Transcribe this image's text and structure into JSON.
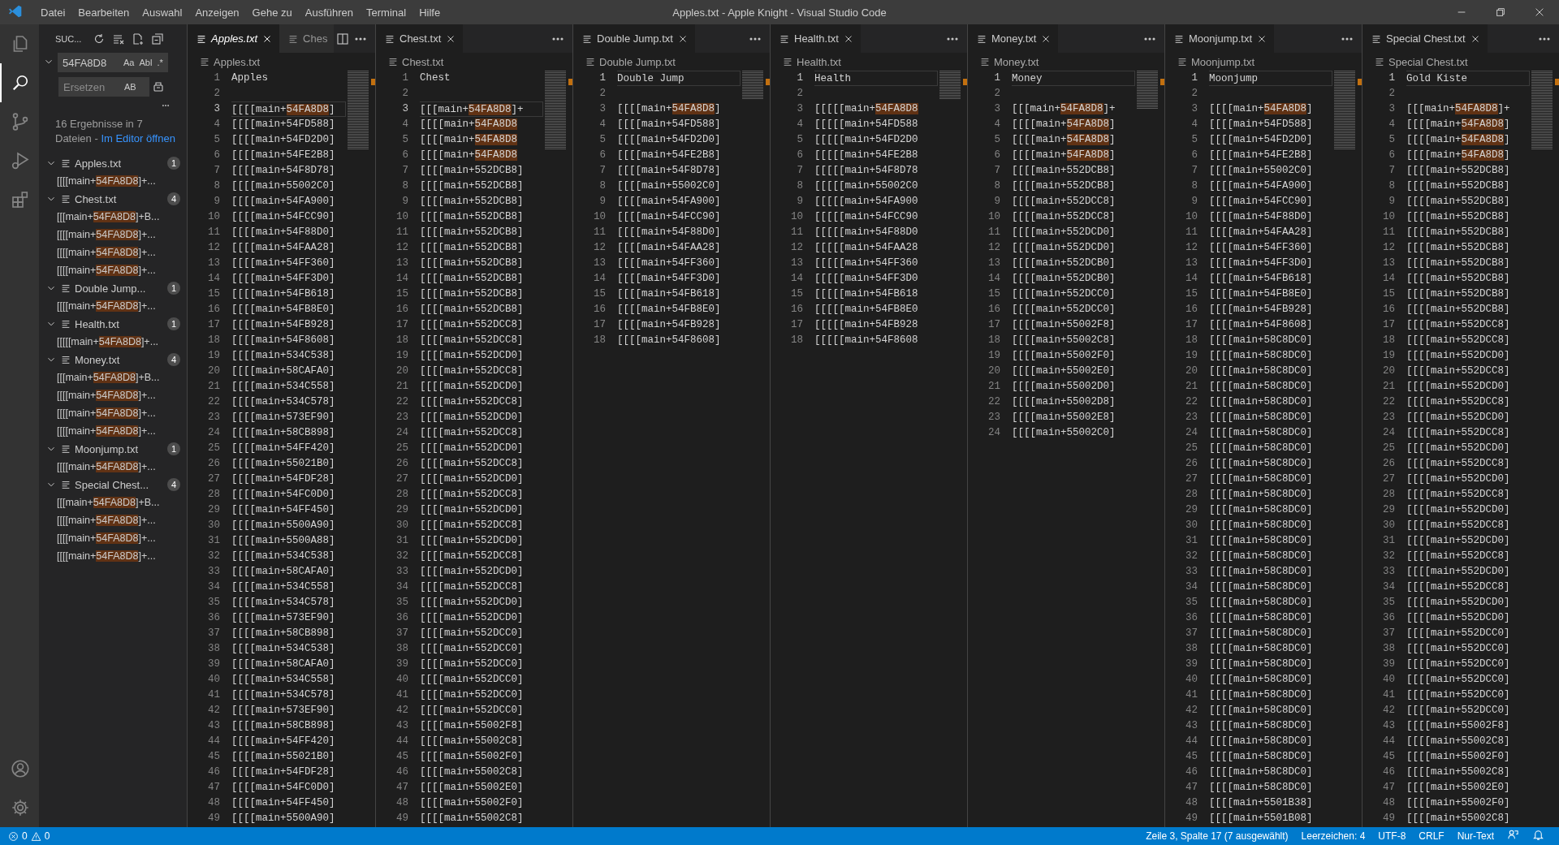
{
  "title_bar": {
    "menus": [
      "Datei",
      "Bearbeiten",
      "Auswahl",
      "Anzeigen",
      "Gehe zu",
      "Ausführen",
      "Terminal",
      "Hilfe"
    ],
    "title": "Apples.txt - Apple Knight - Visual Studio Code"
  },
  "activity_bar": {
    "items": [
      {
        "kind": "files",
        "selected": false
      },
      {
        "kind": "search",
        "selected": true
      },
      {
        "kind": "source-control",
        "selected": false
      },
      {
        "kind": "run",
        "selected": false
      },
      {
        "kind": "extensions",
        "selected": false
      }
    ],
    "bottom": [
      {
        "kind": "account"
      },
      {
        "kind": "settings"
      }
    ]
  },
  "search": {
    "header": "SUC...",
    "query": "54FA8D8",
    "query_options": [
      {
        "label": "Aa",
        "on": false
      },
      {
        "label": "Abl",
        "on": false
      },
      {
        "label": ".*",
        "on": false
      }
    ],
    "replace_placeholder": "Ersetzen",
    "replace_option": "AB",
    "replace_expanded": true,
    "summary": "16 Ergebnisse in 7 Dateien - ",
    "open_link": "Im Editor öffnen",
    "results": [
      {
        "name": "Apples.txt",
        "count": "1",
        "expanded": true,
        "matches": [
          {
            "before": "[[[[main+",
            "match": "54FA8D8",
            "after": "]+..."
          }
        ]
      },
      {
        "name": "Chest.txt",
        "count": "4",
        "expanded": true,
        "matches": [
          {
            "before": "[[[main+",
            "match": "54FA8D8",
            "after": "]+B..."
          },
          {
            "before": "[[[[main+",
            "match": "54FA8D8",
            "after": "]+..."
          },
          {
            "before": "[[[[main+",
            "match": "54FA8D8",
            "after": "]+..."
          },
          {
            "before": "[[[[main+",
            "match": "54FA8D8",
            "after": "]+..."
          }
        ]
      },
      {
        "name": "Double Jump...",
        "count": "1",
        "expanded": true,
        "matches": [
          {
            "before": "[[[[main+",
            "match": "54FA8D8",
            "after": "]+..."
          }
        ]
      },
      {
        "name": "Health.txt",
        "count": "1",
        "expanded": true,
        "matches": [
          {
            "before": "[[[[[main+",
            "match": "54FA8D8",
            "after": "]+..."
          }
        ]
      },
      {
        "name": "Money.txt",
        "count": "4",
        "expanded": true,
        "matches": [
          {
            "before": "[[[main+",
            "match": "54FA8D8",
            "after": "]+B..."
          },
          {
            "before": "[[[[main+",
            "match": "54FA8D8",
            "after": "]+..."
          },
          {
            "before": "[[[[main+",
            "match": "54FA8D8",
            "after": "]+..."
          },
          {
            "before": "[[[[main+",
            "match": "54FA8D8",
            "after": "]+..."
          }
        ]
      },
      {
        "name": "Moonjump.txt",
        "count": "1",
        "expanded": true,
        "matches": [
          {
            "before": "[[[[main+",
            "match": "54FA8D8",
            "after": "]+..."
          }
        ]
      },
      {
        "name": "Special Chest...",
        "count": "4",
        "expanded": true,
        "matches": [
          {
            "before": "[[[main+",
            "match": "54FA8D8",
            "after": "]+B..."
          },
          {
            "before": "[[[[main+",
            "match": "54FA8D8",
            "after": "]+..."
          },
          {
            "before": "[[[[main+",
            "match": "54FA8D8",
            "after": "]+..."
          },
          {
            "before": "[[[[main+",
            "match": "54FA8D8",
            "after": "]+..."
          }
        ]
      }
    ]
  },
  "editor_groups": [
    {
      "focused": true,
      "tabs": [
        {
          "label": "Apples.txt",
          "selected": true,
          "preview": true
        },
        {
          "label": "Ches",
          "selected": false,
          "preview": false
        }
      ],
      "actions": [
        {
          "kind": "split"
        },
        {
          "kind": "more"
        }
      ],
      "breadcrumb": "Apples.txt",
      "lines": [
        {
          "n": "1",
          "text": "Apples",
          "current": false
        },
        {
          "n": "2",
          "current": false
        },
        {
          "n": "3",
          "text": "[[[[main+",
          "match": "54FA8D8",
          "rest": "]",
          "current": true
        },
        {
          "n": "4",
          "text": "[[[[main+54FD588]",
          "current": false
        },
        {
          "n": "5",
          "text": "[[[[main+54FD2D0]",
          "current": false
        },
        {
          "n": "6",
          "text": "[[[[main+54FE2B8]",
          "current": false
        },
        {
          "n": "7",
          "text": "[[[[main+54F8D78]",
          "current": false
        },
        {
          "n": "8",
          "text": "[[[[main+55002C0]",
          "current": false
        },
        {
          "n": "9",
          "text": "[[[[main+54FA900]",
          "current": false
        },
        {
          "n": "10",
          "text": "[[[[main+54FCC90]",
          "current": false
        },
        {
          "n": "11",
          "text": "[[[[main+54F88D0]",
          "current": false
        },
        {
          "n": "12",
          "text": "[[[[main+54FAA28]",
          "current": false
        },
        {
          "n": "13",
          "text": "[[[[main+54FF360]",
          "current": false
        },
        {
          "n": "14",
          "text": "[[[[main+54FF3D0]",
          "current": false
        },
        {
          "n": "15",
          "text": "[[[[main+54FB618]",
          "current": false
        },
        {
          "n": "16",
          "text": "[[[[main+54FB8E0]",
          "current": false
        },
        {
          "n": "17",
          "text": "[[[[main+54FB928]",
          "current": false
        },
        {
          "n": "18",
          "text": "[[[[main+54F8608]",
          "current": false
        },
        {
          "n": "19",
          "text": "[[[[main+534C538]",
          "current": false
        },
        {
          "n": "20",
          "text": "[[[[main+58CAFA0]",
          "current": false
        },
        {
          "n": "21",
          "text": "[[[[main+534C558]",
          "current": false
        },
        {
          "n": "22",
          "text": "[[[[main+534C578]",
          "current": false
        },
        {
          "n": "23",
          "text": "[[[[main+573EF90]",
          "current": false
        },
        {
          "n": "24",
          "text": "[[[[main+58CB898]",
          "current": false
        },
        {
          "n": "25",
          "text": "[[[[main+54FF420]",
          "current": false
        },
        {
          "n": "26",
          "text": "[[[[main+55021B0]",
          "current": false
        },
        {
          "n": "27",
          "text": "[[[[main+54FDF28]",
          "current": false
        },
        {
          "n": "28",
          "text": "[[[[main+54FC0D0]",
          "current": false
        },
        {
          "n": "29",
          "text": "[[[[main+54FF450]",
          "current": false
        },
        {
          "n": "30",
          "text": "[[[[main+5500A90]",
          "current": false
        },
        {
          "n": "31",
          "text": "[[[[main+5500A88]",
          "current": false
        },
        {
          "n": "32",
          "text": "[[[[main+534C538]",
          "current": false
        },
        {
          "n": "33",
          "text": "[[[[main+58CAFA0]",
          "current": false
        },
        {
          "n": "34",
          "text": "[[[[main+534C558]",
          "current": false
        },
        {
          "n": "35",
          "text": "[[[[main+534C578]",
          "current": false
        },
        {
          "n": "36",
          "text": "[[[[main+573EF90]",
          "current": false
        },
        {
          "n": "37",
          "text": "[[[[main+58CB898]",
          "current": false
        },
        {
          "n": "38",
          "text": "[[[[main+534C538]",
          "current": false
        },
        {
          "n": "39",
          "text": "[[[[main+58CAFA0]",
          "current": false
        },
        {
          "n": "40",
          "text": "[[[[main+534C558]",
          "current": false
        },
        {
          "n": "41",
          "text": "[[[[main+534C578]",
          "current": false
        },
        {
          "n": "42",
          "text": "[[[[main+573EF90]",
          "current": false
        },
        {
          "n": "43",
          "text": "[[[[main+58CB898]",
          "current": false
        },
        {
          "n": "44",
          "text": "[[[[main+54FF420]",
          "current": false
        },
        {
          "n": "45",
          "text": "[[[[main+55021B0]",
          "current": false
        },
        {
          "n": "46",
          "text": "[[[[main+54FDF28]",
          "current": false
        },
        {
          "n": "47",
          "text": "[[[[main+54FC0D0]",
          "current": false
        },
        {
          "n": "48",
          "text": "[[[[main+54FF450]",
          "current": false
        },
        {
          "n": "49",
          "text": "[[[[main+5500A90]",
          "current": false
        }
      ]
    },
    {
      "focused": false,
      "tabs": [
        {
          "label": "Chest.txt",
          "selected": true,
          "preview": false
        }
      ],
      "actions": [
        {
          "kind": "more"
        }
      ],
      "breadcrumb": "Chest.txt",
      "lines": [
        {
          "n": "1",
          "text": "Chest",
          "current": false
        },
        {
          "n": "2",
          "current": false
        },
        {
          "n": "3",
          "text": "[[[main+",
          "match": "54FA8D8",
          "rest": "]+",
          "current": true
        },
        {
          "n": "4",
          "text": "[[[[main+",
          "match": "54FA8D8",
          "current": false
        },
        {
          "n": "5",
          "text": "[[[[main+",
          "match": "54FA8D8",
          "current": false
        },
        {
          "n": "6",
          "text": "[[[[main+",
          "match": "54FA8D8",
          "current": false
        },
        {
          "n": "7",
          "text": "[[[[main+552DCB8]",
          "current": false
        },
        {
          "n": "8",
          "text": "[[[[main+552DCB8]",
          "current": false
        },
        {
          "n": "9",
          "text": "[[[[main+552DCB8]",
          "current": false
        },
        {
          "n": "10",
          "text": "[[[[main+552DCB8]",
          "current": false
        },
        {
          "n": "11",
          "text": "[[[[main+552DCB8]",
          "current": false
        },
        {
          "n": "12",
          "text": "[[[[main+552DCB8]",
          "current": false
        },
        {
          "n": "13",
          "text": "[[[[main+552DCB8]",
          "current": false
        },
        {
          "n": "14",
          "text": "[[[[main+552DCB8]",
          "current": false
        },
        {
          "n": "15",
          "text": "[[[[main+552DCB8]",
          "current": false
        },
        {
          "n": "16",
          "text": "[[[[main+552DCB8]",
          "current": false
        },
        {
          "n": "17",
          "text": "[[[[main+552DCC8]",
          "current": false
        },
        {
          "n": "18",
          "text": "[[[[main+552DCC8]",
          "current": false
        },
        {
          "n": "19",
          "text": "[[[[main+552DCD0]",
          "current": false
        },
        {
          "n": "20",
          "text": "[[[[main+552DCC8]",
          "current": false
        },
        {
          "n": "21",
          "text": "[[[[main+552DCD0]",
          "current": false
        },
        {
          "n": "22",
          "text": "[[[[main+552DCC8]",
          "current": false
        },
        {
          "n": "23",
          "text": "[[[[main+552DCD0]",
          "current": false
        },
        {
          "n": "24",
          "text": "[[[[main+552DCC8]",
          "current": false
        },
        {
          "n": "25",
          "text": "[[[[main+552DCD0]",
          "current": false
        },
        {
          "n": "26",
          "text": "[[[[main+552DCC8]",
          "current": false
        },
        {
          "n": "27",
          "text": "[[[[main+552DCD0]",
          "current": false
        },
        {
          "n": "28",
          "text": "[[[[main+552DCC8]",
          "current": false
        },
        {
          "n": "29",
          "text": "[[[[main+552DCD0]",
          "current": false
        },
        {
          "n": "30",
          "text": "[[[[main+552DCC8]",
          "current": false
        },
        {
          "n": "31",
          "text": "[[[[main+552DCD0]",
          "current": false
        },
        {
          "n": "32",
          "text": "[[[[main+552DCC8]",
          "current": false
        },
        {
          "n": "33",
          "text": "[[[[main+552DCD0]",
          "current": false
        },
        {
          "n": "34",
          "text": "[[[[main+552DCC8]",
          "current": false
        },
        {
          "n": "35",
          "text": "[[[[main+552DCD0]",
          "current": false
        },
        {
          "n": "36",
          "text": "[[[[main+552DCD0]",
          "current": false
        },
        {
          "n": "37",
          "text": "[[[[main+552DCC0]",
          "current": false
        },
        {
          "n": "38",
          "text": "[[[[main+552DCC0]",
          "current": false
        },
        {
          "n": "39",
          "text": "[[[[main+552DCC0]",
          "current": false
        },
        {
          "n": "40",
          "text": "[[[[main+552DCC0]",
          "current": false
        },
        {
          "n": "41",
          "text": "[[[[main+552DCC0]",
          "current": false
        },
        {
          "n": "42",
          "text": "[[[[main+552DCC0]",
          "current": false
        },
        {
          "n": "43",
          "text": "[[[[main+55002F8]",
          "current": false
        },
        {
          "n": "44",
          "text": "[[[[main+55002C8]",
          "current": false
        },
        {
          "n": "45",
          "text": "[[[[main+55002F0]",
          "current": false
        },
        {
          "n": "46",
          "text": "[[[[main+55002C8]",
          "current": false
        },
        {
          "n": "47",
          "text": "[[[[main+55002E0]",
          "current": false
        },
        {
          "n": "48",
          "text": "[[[[main+55002F0]",
          "current": false
        },
        {
          "n": "49",
          "text": "[[[[main+55002C8]",
          "current": false
        }
      ]
    },
    {
      "focused": false,
      "tabs": [
        {
          "label": "Double Jump.txt",
          "selected": true,
          "preview": false
        }
      ],
      "actions": [
        {
          "kind": "more"
        }
      ],
      "breadcrumb": "Double Jump.txt",
      "lines": [
        {
          "n": "1",
          "text": "Double Jump",
          "current": true
        },
        {
          "n": "2",
          "current": false
        },
        {
          "n": "3",
          "text": "[[[[main+",
          "match": "54FA8D8",
          "rest": "]",
          "current": false
        },
        {
          "n": "4",
          "text": "[[[[main+54FD588]",
          "current": false
        },
        {
          "n": "5",
          "text": "[[[[main+54FD2D0]",
          "current": false
        },
        {
          "n": "6",
          "text": "[[[[main+54FE2B8]",
          "current": false
        },
        {
          "n": "7",
          "text": "[[[[main+54F8D78]",
          "current": false
        },
        {
          "n": "8",
          "text": "[[[[main+55002C0]",
          "current": false
        },
        {
          "n": "9",
          "text": "[[[[main+54FA900]",
          "current": false
        },
        {
          "n": "10",
          "text": "[[[[main+54FCC90]",
          "current": false
        },
        {
          "n": "11",
          "text": "[[[[main+54F88D0]",
          "current": false
        },
        {
          "n": "12",
          "text": "[[[[main+54FAA28]",
          "current": false
        },
        {
          "n": "13",
          "text": "[[[[main+54FF360]",
          "current": false
        },
        {
          "n": "14",
          "text": "[[[[main+54FF3D0]",
          "current": false
        },
        {
          "n": "15",
          "text": "[[[[main+54FB618]",
          "current": false
        },
        {
          "n": "16",
          "text": "[[[[main+54FB8E0]",
          "current": false
        },
        {
          "n": "17",
          "text": "[[[[main+54FB928]",
          "current": false
        },
        {
          "n": "18",
          "text": "[[[[main+54F8608]",
          "current": false
        }
      ]
    },
    {
      "focused": false,
      "tabs": [
        {
          "label": "Health.txt",
          "selected": true,
          "preview": false
        }
      ],
      "actions": [
        {
          "kind": "more"
        }
      ],
      "breadcrumb": "Health.txt",
      "lines": [
        {
          "n": "1",
          "text": "Health",
          "current": true
        },
        {
          "n": "2",
          "current": false
        },
        {
          "n": "3",
          "text": "[[[[[main+",
          "match": "54FA8D8",
          "current": false
        },
        {
          "n": "4",
          "text": "[[[[[main+54FD588",
          "current": false
        },
        {
          "n": "5",
          "text": "[[[[[main+54FD2D0",
          "current": false
        },
        {
          "n": "6",
          "text": "[[[[[main+54FE2B8",
          "current": false
        },
        {
          "n": "7",
          "text": "[[[[[main+54F8D78",
          "current": false
        },
        {
          "n": "8",
          "text": "[[[[[main+55002C0",
          "current": false
        },
        {
          "n": "9",
          "text": "[[[[[main+54FA900",
          "current": false
        },
        {
          "n": "10",
          "text": "[[[[[main+54FCC90",
          "current": false
        },
        {
          "n": "11",
          "text": "[[[[[main+54F88D0",
          "current": false
        },
        {
          "n": "12",
          "text": "[[[[[main+54FAA28",
          "current": false
        },
        {
          "n": "13",
          "text": "[[[[[main+54FF360",
          "current": false
        },
        {
          "n": "14",
          "text": "[[[[[main+54FF3D0",
          "current": false
        },
        {
          "n": "15",
          "text": "[[[[[main+54FB618",
          "current": false
        },
        {
          "n": "16",
          "text": "[[[[[main+54FB8E0",
          "current": false
        },
        {
          "n": "17",
          "text": "[[[[[main+54FB928",
          "current": false
        },
        {
          "n": "18",
          "text": "[[[[[main+54F8608",
          "current": false
        }
      ]
    },
    {
      "focused": false,
      "tabs": [
        {
          "label": "Money.txt",
          "selected": true,
          "preview": false
        }
      ],
      "actions": [
        {
          "kind": "more"
        }
      ],
      "breadcrumb": "Money.txt",
      "lines": [
        {
          "n": "1",
          "text": "Money",
          "current": true
        },
        {
          "n": "2",
          "current": false
        },
        {
          "n": "3",
          "text": "[[[main+",
          "match": "54FA8D8",
          "rest": "]+",
          "current": false
        },
        {
          "n": "4",
          "text": "[[[[main+",
          "match": "54FA8D8",
          "rest": "]",
          "current": false
        },
        {
          "n": "5",
          "text": "[[[[main+",
          "match": "54FA8D8",
          "rest": "]",
          "current": false
        },
        {
          "n": "6",
          "text": "[[[[main+",
          "match": "54FA8D8",
          "rest": "]",
          "current": false
        },
        {
          "n": "7",
          "text": "[[[[main+552DCB8]",
          "current": false
        },
        {
          "n": "8",
          "text": "[[[[main+552DCB8]",
          "current": false
        },
        {
          "n": "9",
          "text": "[[[[main+552DCC8]",
          "current": false
        },
        {
          "n": "10",
          "text": "[[[[main+552DCC8]",
          "current": false
        },
        {
          "n": "11",
          "text": "[[[[main+552DCD0]",
          "current": false
        },
        {
          "n": "12",
          "text": "[[[[main+552DCD0]",
          "current": false
        },
        {
          "n": "13",
          "text": "[[[[main+552DCB0]",
          "current": false
        },
        {
          "n": "14",
          "text": "[[[[main+552DCB0]",
          "current": false
        },
        {
          "n": "15",
          "text": "[[[[main+552DCC0]",
          "current": false
        },
        {
          "n": "16",
          "text": "[[[[main+552DCC0]",
          "current": false
        },
        {
          "n": "17",
          "text": "[[[[main+55002F8]",
          "current": false
        },
        {
          "n": "18",
          "text": "[[[[main+55002C8]",
          "current": false
        },
        {
          "n": "19",
          "text": "[[[[main+55002F0]",
          "current": false
        },
        {
          "n": "20",
          "text": "[[[[main+55002E0]",
          "current": false
        },
        {
          "n": "21",
          "text": "[[[[main+55002D0]",
          "current": false
        },
        {
          "n": "22",
          "text": "[[[[main+55002D8]",
          "current": false
        },
        {
          "n": "23",
          "text": "[[[[main+55002E8]",
          "current": false
        },
        {
          "n": "24",
          "text": "[[[[main+55002C0]",
          "current": false
        }
      ]
    },
    {
      "focused": false,
      "tabs": [
        {
          "label": "Moonjump.txt",
          "selected": true,
          "preview": false
        }
      ],
      "actions": [
        {
          "kind": "more"
        }
      ],
      "breadcrumb": "Moonjump.txt",
      "lines": [
        {
          "n": "1",
          "text": "Moonjump",
          "current": true
        },
        {
          "n": "2",
          "current": false
        },
        {
          "n": "3",
          "text": "[[[[main+",
          "match": "54FA8D8",
          "rest": "]",
          "current": false
        },
        {
          "n": "4",
          "text": "[[[[main+54FD588]",
          "current": false
        },
        {
          "n": "5",
          "text": "[[[[main+54FD2D0]",
          "current": false
        },
        {
          "n": "6",
          "text": "[[[[main+54FE2B8]",
          "current": false
        },
        {
          "n": "7",
          "text": "[[[[main+55002C0]",
          "current": false
        },
        {
          "n": "8",
          "text": "[[[[main+54FA900]",
          "current": false
        },
        {
          "n": "9",
          "text": "[[[[main+54FCC90]",
          "current": false
        },
        {
          "n": "10",
          "text": "[[[[main+54F88D0]",
          "current": false
        },
        {
          "n": "11",
          "text": "[[[[main+54FAA28]",
          "current": false
        },
        {
          "n": "12",
          "text": "[[[[main+54FF360]",
          "current": false
        },
        {
          "n": "13",
          "text": "[[[[main+54FF3D0]",
          "current": false
        },
        {
          "n": "14",
          "text": "[[[[main+54FB618]",
          "current": false
        },
        {
          "n": "15",
          "text": "[[[[main+54FB8E0]",
          "current": false
        },
        {
          "n": "16",
          "text": "[[[[main+54FB928]",
          "current": false
        },
        {
          "n": "17",
          "text": "[[[[main+54F8608]",
          "current": false
        },
        {
          "n": "18",
          "text": "[[[[main+58C8DC0]",
          "current": false
        },
        {
          "n": "19",
          "text": "[[[[main+58C8DC0]",
          "current": false
        },
        {
          "n": "20",
          "text": "[[[[main+58C8DC0]",
          "current": false
        },
        {
          "n": "21",
          "text": "[[[[main+58C8DC0]",
          "current": false
        },
        {
          "n": "22",
          "text": "[[[[main+58C8DC0]",
          "current": false
        },
        {
          "n": "23",
          "text": "[[[[main+58C8DC0]",
          "current": false
        },
        {
          "n": "24",
          "text": "[[[[main+58C8DC0]",
          "current": false
        },
        {
          "n": "25",
          "text": "[[[[main+58C8DC0]",
          "current": false
        },
        {
          "n": "26",
          "text": "[[[[main+58C8DC0]",
          "current": false
        },
        {
          "n": "27",
          "text": "[[[[main+58C8DC0]",
          "current": false
        },
        {
          "n": "28",
          "text": "[[[[main+58C8DC0]",
          "current": false
        },
        {
          "n": "29",
          "text": "[[[[main+58C8DC0]",
          "current": false
        },
        {
          "n": "30",
          "text": "[[[[main+58C8DC0]",
          "current": false
        },
        {
          "n": "31",
          "text": "[[[[main+58C8DC0]",
          "current": false
        },
        {
          "n": "32",
          "text": "[[[[main+58C8DC0]",
          "current": false
        },
        {
          "n": "33",
          "text": "[[[[main+58C8DC0]",
          "current": false
        },
        {
          "n": "34",
          "text": "[[[[main+58C8DC0]",
          "current": false
        },
        {
          "n": "35",
          "text": "[[[[main+58C8DC0]",
          "current": false
        },
        {
          "n": "36",
          "text": "[[[[main+58C8DC0]",
          "current": false
        },
        {
          "n": "37",
          "text": "[[[[main+58C8DC0]",
          "current": false
        },
        {
          "n": "38",
          "text": "[[[[main+58C8DC0]",
          "current": false
        },
        {
          "n": "39",
          "text": "[[[[main+58C8DC0]",
          "current": false
        },
        {
          "n": "40",
          "text": "[[[[main+58C8DC0]",
          "current": false
        },
        {
          "n": "41",
          "text": "[[[[main+58C8DC0]",
          "current": false
        },
        {
          "n": "42",
          "text": "[[[[main+58C8DC0]",
          "current": false
        },
        {
          "n": "43",
          "text": "[[[[main+58C8DC0]",
          "current": false
        },
        {
          "n": "44",
          "text": "[[[[main+58C8DC0]",
          "current": false
        },
        {
          "n": "45",
          "text": "[[[[main+58C8DC0]",
          "current": false
        },
        {
          "n": "46",
          "text": "[[[[main+58C8DC0]",
          "current": false
        },
        {
          "n": "47",
          "text": "[[[[main+58C8DC0]",
          "current": false
        },
        {
          "n": "48",
          "text": "[[[[main+5501B38]",
          "current": false
        },
        {
          "n": "49",
          "text": "[[[[main+5501B08]",
          "current": false
        }
      ]
    },
    {
      "focused": false,
      "tabs": [
        {
          "label": "Special Chest.txt",
          "selected": true,
          "preview": false
        }
      ],
      "actions": [
        {
          "kind": "more"
        }
      ],
      "breadcrumb": "Special Chest.txt",
      "lines": [
        {
          "n": "1",
          "text": "Gold Kiste",
          "current": true
        },
        {
          "n": "2",
          "current": false
        },
        {
          "n": "3",
          "text": "[[[main+",
          "match": "54FA8D8",
          "rest": "]+",
          "current": false
        },
        {
          "n": "4",
          "text": "[[[[main+",
          "match": "54FA8D8",
          "rest": "]",
          "current": false
        },
        {
          "n": "5",
          "text": "[[[[main+",
          "match": "54FA8D8",
          "rest": "]",
          "current": false
        },
        {
          "n": "6",
          "text": "[[[[main+",
          "match": "54FA8D8",
          "rest": "]",
          "current": false
        },
        {
          "n": "7",
          "text": "[[[[main+552DCB8]",
          "current": false
        },
        {
          "n": "8",
          "text": "[[[[main+552DCB8]",
          "current": false
        },
        {
          "n": "9",
          "text": "[[[[main+552DCB8]",
          "current": false
        },
        {
          "n": "10",
          "text": "[[[[main+552DCB8]",
          "current": false
        },
        {
          "n": "11",
          "text": "[[[[main+552DCB8]",
          "current": false
        },
        {
          "n": "12",
          "text": "[[[[main+552DCB8]",
          "current": false
        },
        {
          "n": "13",
          "text": "[[[[main+552DCB8]",
          "current": false
        },
        {
          "n": "14",
          "text": "[[[[main+552DCB8]",
          "current": false
        },
        {
          "n": "15",
          "text": "[[[[main+552DCB8]",
          "current": false
        },
        {
          "n": "16",
          "text": "[[[[main+552DCB8]",
          "current": false
        },
        {
          "n": "17",
          "text": "[[[[main+552DCC8]",
          "current": false
        },
        {
          "n": "18",
          "text": "[[[[main+552DCC8]",
          "current": false
        },
        {
          "n": "19",
          "text": "[[[[main+552DCD0]",
          "current": false
        },
        {
          "n": "20",
          "text": "[[[[main+552DCC8]",
          "current": false
        },
        {
          "n": "21",
          "text": "[[[[main+552DCD0]",
          "current": false
        },
        {
          "n": "22",
          "text": "[[[[main+552DCC8]",
          "current": false
        },
        {
          "n": "23",
          "text": "[[[[main+552DCD0]",
          "current": false
        },
        {
          "n": "24",
          "text": "[[[[main+552DCC8]",
          "current": false
        },
        {
          "n": "25",
          "text": "[[[[main+552DCD0]",
          "current": false
        },
        {
          "n": "26",
          "text": "[[[[main+552DCC8]",
          "current": false
        },
        {
          "n": "27",
          "text": "[[[[main+552DCD0]",
          "current": false
        },
        {
          "n": "28",
          "text": "[[[[main+552DCC8]",
          "current": false
        },
        {
          "n": "29",
          "text": "[[[[main+552DCD0]",
          "current": false
        },
        {
          "n": "30",
          "text": "[[[[main+552DCC8]",
          "current": false
        },
        {
          "n": "31",
          "text": "[[[[main+552DCD0]",
          "current": false
        },
        {
          "n": "32",
          "text": "[[[[main+552DCC8]",
          "current": false
        },
        {
          "n": "33",
          "text": "[[[[main+552DCD0]",
          "current": false
        },
        {
          "n": "34",
          "text": "[[[[main+552DCC8]",
          "current": false
        },
        {
          "n": "35",
          "text": "[[[[main+552DCD0]",
          "current": false
        },
        {
          "n": "36",
          "text": "[[[[main+552DCD0]",
          "current": false
        },
        {
          "n": "37",
          "text": "[[[[main+552DCC0]",
          "current": false
        },
        {
          "n": "38",
          "text": "[[[[main+552DCC0]",
          "current": false
        },
        {
          "n": "39",
          "text": "[[[[main+552DCC0]",
          "current": false
        },
        {
          "n": "40",
          "text": "[[[[main+552DCC0]",
          "current": false
        },
        {
          "n": "41",
          "text": "[[[[main+552DCC0]",
          "current": false
        },
        {
          "n": "42",
          "text": "[[[[main+552DCC0]",
          "current": false
        },
        {
          "n": "43",
          "text": "[[[[main+55002F8]",
          "current": false
        },
        {
          "n": "44",
          "text": "[[[[main+55002C8]",
          "current": false
        },
        {
          "n": "45",
          "text": "[[[[main+55002F0]",
          "current": false
        },
        {
          "n": "46",
          "text": "[[[[main+55002C8]",
          "current": false
        },
        {
          "n": "47",
          "text": "[[[[main+55002E0]",
          "current": false
        },
        {
          "n": "48",
          "text": "[[[[main+55002F0]",
          "current": false
        },
        {
          "n": "49",
          "text": "[[[[main+55002C8]",
          "current": false
        }
      ]
    }
  ],
  "status_bar": {
    "errors": "0",
    "warnings": "0",
    "items": [
      "Zeile 3, Spalte 17 (7 ausgewählt)",
      "Leerzeichen: 4",
      "UTF-8",
      "CRLF",
      "Nur-Text"
    ]
  }
}
